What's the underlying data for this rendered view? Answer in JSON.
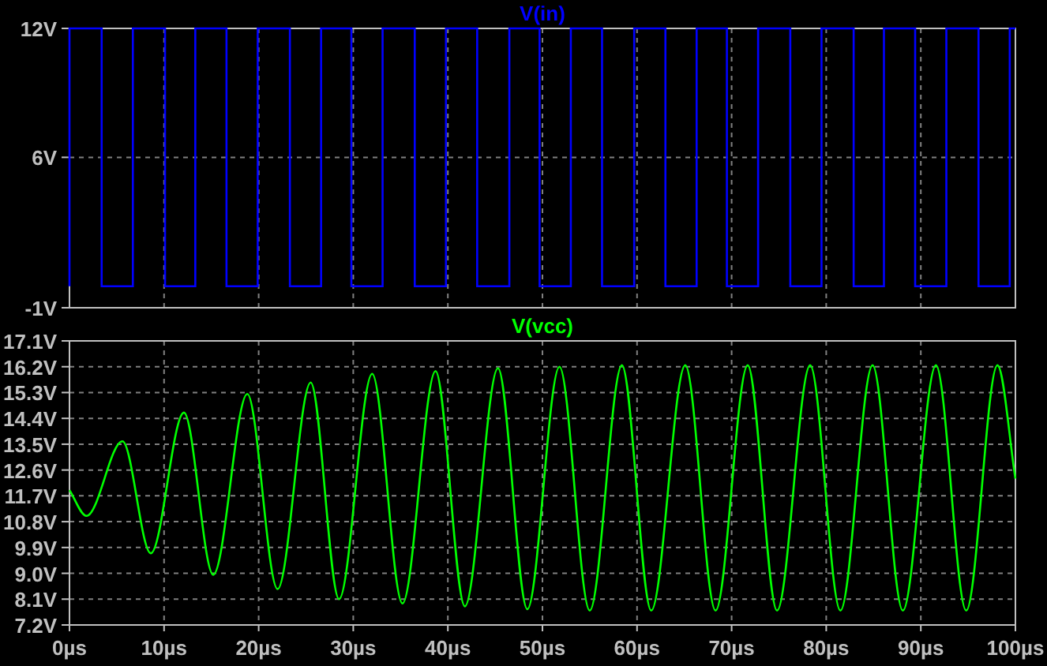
{
  "plots": [
    {
      "chart_data": {
        "type": "line",
        "grid": true,
        "xlim": [
          0,
          100
        ],
        "ylim": [
          -1,
          12
        ],
        "yticks": [
          {
            "value": -1,
            "label": "-1V"
          },
          {
            "value": 6,
            "label": "6V"
          },
          {
            "value": 12,
            "label": "12V"
          }
        ],
        "x": [
          0,
          0,
          3.4,
          3.4,
          6.7,
          6.7,
          10.1,
          10.1,
          13.3,
          13.3,
          16.6,
          16.6,
          19.9,
          19.9,
          23.3,
          23.3,
          26.6,
          26.6,
          29.8,
          29.8,
          33.1,
          33.1,
          36.5,
          36.5,
          39.8,
          39.8,
          43.1,
          43.1,
          46.5,
          46.5,
          49.7,
          49.7,
          53,
          53,
          56.3,
          56.3,
          59.7,
          59.7,
          63,
          63,
          66.3,
          66.3,
          69.5,
          69.5,
          72.8,
          72.8,
          76.2,
          76.2,
          79.5,
          79.5,
          82.9,
          82.9,
          86.1,
          86.1,
          89.4,
          89.4,
          92.7,
          92.7,
          96.1,
          96.1,
          99.4,
          99.4,
          100
        ],
        "series": [
          {
            "name": "V(in)",
            "color": "#0000ff",
            "values": [
              0,
              12,
              12,
              0,
              0,
              12,
              12,
              0,
              0,
              12,
              12,
              0,
              0,
              12,
              12,
              0,
              0,
              12,
              12,
              0,
              0,
              12,
              12,
              0,
              0,
              12,
              12,
              0,
              0,
              12,
              12,
              0,
              0,
              12,
              12,
              0,
              0,
              12,
              12,
              0,
              0,
              12,
              12,
              0,
              0,
              12,
              12,
              0,
              0,
              12,
              12,
              0,
              0,
              12,
              12,
              0,
              0,
              12,
              12,
              0,
              0,
              12,
              12
            ]
          }
        ]
      }
    },
    {
      "chart_data": {
        "type": "line",
        "grid": true,
        "xlim": [
          0,
          100
        ],
        "ylim": [
          7.2,
          17.1
        ],
        "xticks": [
          {
            "value": 0,
            "label": "0µs"
          },
          {
            "value": 10,
            "label": "10µs"
          },
          {
            "value": 20,
            "label": "20µs"
          },
          {
            "value": 30,
            "label": "30µs"
          },
          {
            "value": 40,
            "label": "40µs"
          },
          {
            "value": 50,
            "label": "50µs"
          },
          {
            "value": 60,
            "label": "60µs"
          },
          {
            "value": 70,
            "label": "70µs"
          },
          {
            "value": 80,
            "label": "80µs"
          },
          {
            "value": 90,
            "label": "90µs"
          },
          {
            "value": 100,
            "label": "100µs"
          }
        ],
        "yticks": [
          {
            "value": 7.2,
            "label": "7.2V"
          },
          {
            "value": 8.1,
            "label": "8.1V"
          },
          {
            "value": 9.0,
            "label": "9.0V"
          },
          {
            "value": 9.9,
            "label": "9.9V"
          },
          {
            "value": 10.8,
            "label": "10.8V"
          },
          {
            "value": 11.7,
            "label": "11.7V"
          },
          {
            "value": 12.6,
            "label": "12.6V"
          },
          {
            "value": 13.5,
            "label": "13.5V"
          },
          {
            "value": 14.4,
            "label": "14.4V"
          },
          {
            "value": 15.3,
            "label": "15.3V"
          },
          {
            "value": 16.2,
            "label": "16.2V"
          },
          {
            "value": 17.1,
            "label": "17.1V"
          }
        ],
        "x": [
          0,
          1.8,
          5.6,
          8.6,
          12.1,
          15.2,
          18.8,
          22,
          25.5,
          28.5,
          32,
          35.2,
          38.7,
          41.8,
          45.3,
          48.4,
          51.8,
          55,
          58.4,
          61.5,
          65.1,
          68.3,
          71.7,
          74.8,
          78.3,
          81.5,
          84.9,
          88.1,
          91.6,
          94.8,
          98.1,
          100
        ],
        "series": [
          {
            "name": "V(vcc)",
            "color": "#00ff00",
            "values": [
              11.9,
              11.0,
              13.6,
              9.7,
              14.6,
              8.95,
              15.25,
              8.45,
              15.65,
              8.1,
              15.95,
              7.95,
              16.05,
              7.85,
              16.15,
              7.75,
              16.2,
              7.7,
              16.25,
              7.7,
              16.25,
              7.7,
              16.25,
              7.7,
              16.25,
              7.7,
              16.25,
              7.7,
              16.25,
              7.7,
              16.25,
              12.3
            ]
          }
        ]
      }
    }
  ]
}
